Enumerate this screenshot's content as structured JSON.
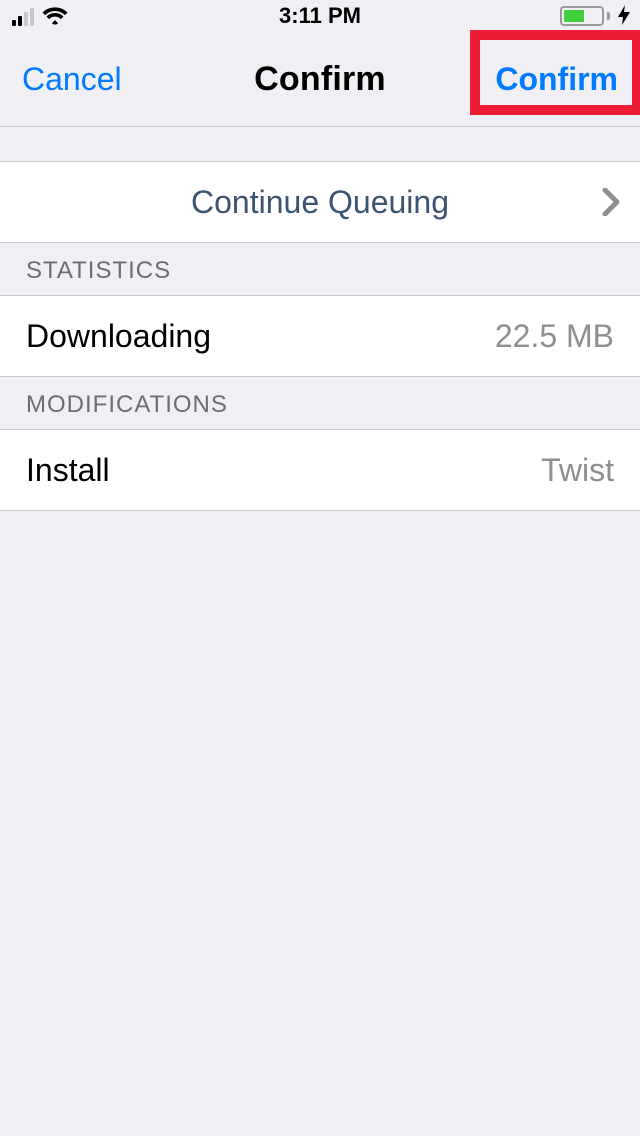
{
  "status": {
    "time": "3:11 PM"
  },
  "nav": {
    "cancel": "Cancel",
    "title": "Confirm",
    "confirm": "Confirm"
  },
  "queue": {
    "label": "Continue Queuing"
  },
  "sections": {
    "statistics_header": "STATISTICS",
    "downloading_label": "Downloading",
    "downloading_value": "22.5 MB",
    "modifications_header": "MODIFICATIONS",
    "install_label": "Install",
    "install_value": "Twist"
  }
}
